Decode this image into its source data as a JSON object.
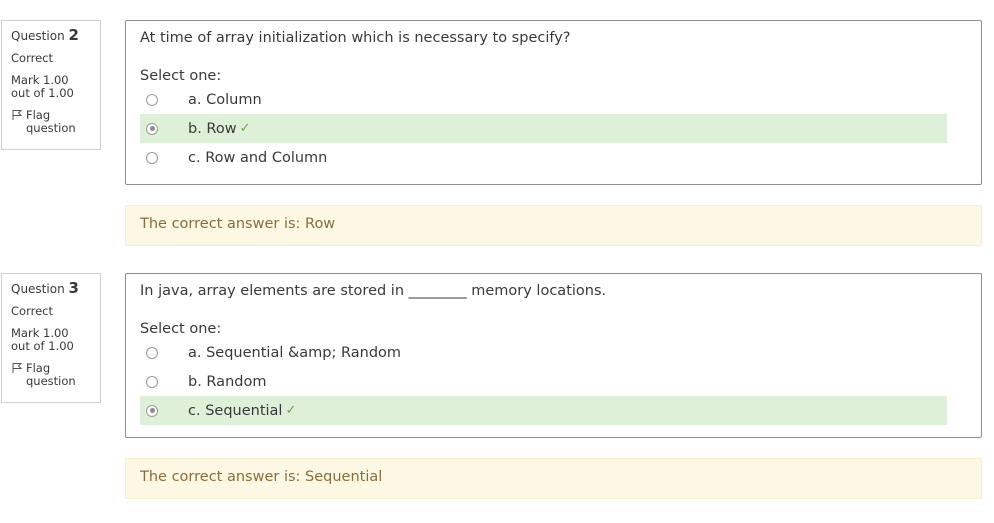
{
  "questions": [
    {
      "info": {
        "question_word": "Question",
        "number": "2",
        "state": "Correct",
        "grade": "Mark 1.00 out of 1.00",
        "flag": "Flag question"
      },
      "text": "At time of array initialization which is necessary to specify?",
      "prompt": "Select one:",
      "options": [
        {
          "label": "a. Column",
          "selected": false,
          "correct": false
        },
        {
          "label": "b. Row",
          "selected": true,
          "correct": true
        },
        {
          "label": "c. Row and Column",
          "selected": false,
          "correct": false
        }
      ],
      "feedback": "The correct answer is: Row"
    },
    {
      "info": {
        "question_word": "Question",
        "number": "3",
        "state": "Correct",
        "grade": "Mark 1.00 out of 1.00",
        "flag": "Flag question"
      },
      "text": "In java, array elements are stored in ________ memory locations.",
      "prompt": "Select one:",
      "options": [
        {
          "label": "a. Sequential &amp; Random",
          "selected": false,
          "correct": false
        },
        {
          "label": "b. Random",
          "selected": false,
          "correct": false
        },
        {
          "label": "c. Sequential",
          "selected": true,
          "correct": true
        }
      ],
      "feedback": "The correct answer is: Sequential"
    }
  ],
  "colors": {
    "correct_bg": "#dff0d8",
    "feedback_bg": "#fcf8e3",
    "feedback_text": "#8a6d3b",
    "check": "#6aa84f"
  },
  "icons": {
    "flag": "flag-icon",
    "correct": "check-icon"
  }
}
